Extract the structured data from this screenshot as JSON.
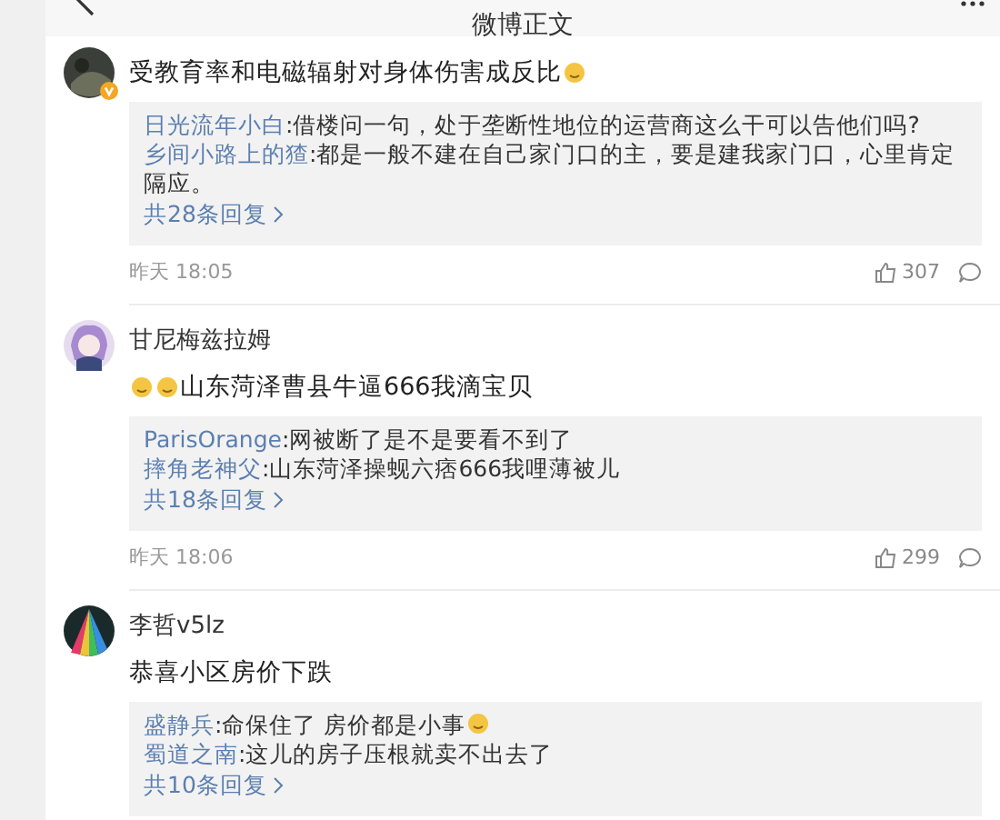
{
  "header": {
    "title": "微博正文"
  },
  "comments": [
    {
      "verified": true,
      "content": [
        {
          "kind": "text",
          "text": "受教育率和电磁辐射对身体伤害成反比"
        },
        {
          "kind": "emoji"
        }
      ],
      "replies": [
        {
          "user": "日光流年小白",
          "content": [
            {
              "kind": "text",
              "text": ":借楼问一句，处于垄断性地位的运营商这么干可以告他们吗?"
            }
          ]
        },
        {
          "user": "乡间小路上的猹",
          "content": [
            {
              "kind": "text",
              "text": ":都是一般不建在自己家门口的主，要是建我家门口，心里肯定隔应。"
            }
          ]
        }
      ],
      "more": "共28条回复",
      "time": "昨天 18:05",
      "likes": "307"
    },
    {
      "author": "甘尼梅兹拉姆",
      "verified": false,
      "content": [
        {
          "kind": "emoji"
        },
        {
          "kind": "emoji"
        },
        {
          "kind": "text",
          "text": "山东菏泽曹县牛逼666我滴宝贝"
        }
      ],
      "replies": [
        {
          "user": "ParisOrange",
          "content": [
            {
              "kind": "text",
              "text": ":网被断了是不是要看不到了"
            }
          ]
        },
        {
          "user": "摔角老神父",
          "content": [
            {
              "kind": "text",
              "text": ":山东菏泽操蚬六痞666我哩薄被儿"
            }
          ]
        }
      ],
      "more": "共18条回复",
      "time": "昨天 18:06",
      "likes": "299"
    },
    {
      "author": "李哲v5lz",
      "verified": false,
      "content": [
        {
          "kind": "text",
          "text": "恭喜小区房价下跌"
        }
      ],
      "replies": [
        {
          "user": "盛静兵",
          "content": [
            {
              "kind": "text",
              "text": ":命保住了 房价都是小事"
            },
            {
              "kind": "emoji"
            }
          ]
        },
        {
          "user": "蜀道之南",
          "content": [
            {
              "kind": "text",
              "text": ":这儿的房子压根就卖不出去了"
            }
          ]
        }
      ],
      "more": "共10条回复"
    }
  ]
}
